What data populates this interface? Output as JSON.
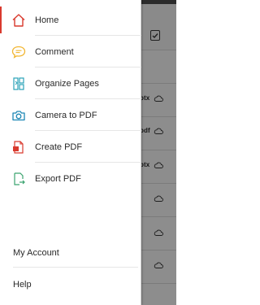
{
  "drawer": {
    "items": [
      {
        "label": "Home",
        "icon": "home-icon",
        "selected": true
      },
      {
        "label": "Comment",
        "icon": "comment-icon"
      },
      {
        "label": "Organize Pages",
        "icon": "organize-pages-icon"
      },
      {
        "label": "Camera to PDF",
        "icon": "camera-icon"
      },
      {
        "label": "Create PDF",
        "icon": "create-pdf-icon"
      },
      {
        "label": "Export PDF",
        "icon": "export-pdf-icon"
      }
    ],
    "footer": [
      {
        "label": "My Account"
      },
      {
        "label": "Help"
      }
    ]
  },
  "background": {
    "file_extensions": [
      "ptx",
      "pdf",
      "ptx"
    ],
    "icons": [
      "checklist-icon",
      "cloud-icon"
    ]
  },
  "colors": {
    "accent_red": "#d93a2e",
    "comment_yellow": "#f2b632",
    "organize_teal": "#2aa2b8",
    "camera_blue": "#1d87b5",
    "export_green": "#3ba36f"
  }
}
